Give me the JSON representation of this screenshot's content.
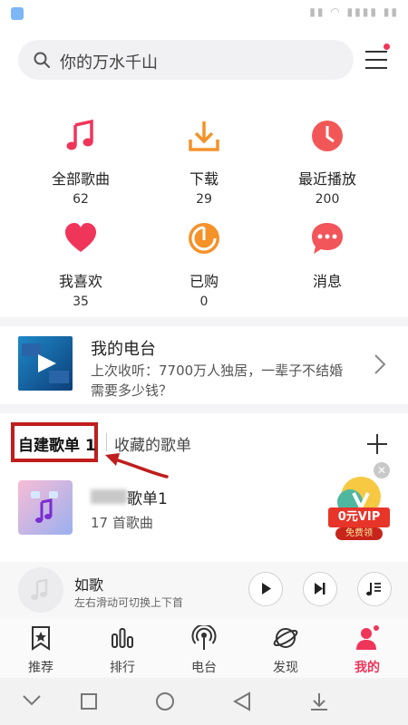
{
  "search": {
    "placeholder": "你的万水千山"
  },
  "grid": [
    {
      "label": "全部歌曲",
      "count": "62",
      "icon": "music-note-icon"
    },
    {
      "label": "下载",
      "count": "29",
      "icon": "download-icon"
    },
    {
      "label": "最近播放",
      "count": "200",
      "icon": "clock-icon"
    },
    {
      "label": "我喜欢",
      "count": "35",
      "icon": "heart-icon"
    },
    {
      "label": "已购",
      "count": "0",
      "icon": "purchased-disc-icon"
    },
    {
      "label": "消息",
      "count": "",
      "icon": "message-icon"
    }
  ],
  "radio": {
    "title": "我的电台",
    "desc": "上次收听：7700万人独居，一辈子不结婚需要多少钱？"
  },
  "tabs": {
    "created": "自建歌单 1",
    "favorited": "收藏的歌单"
  },
  "playlist": {
    "name": "歌单1",
    "count": "17 首歌曲"
  },
  "ad": {
    "main": "0元VIP",
    "sub": "免费领"
  },
  "player": {
    "title": "如歌",
    "hint": "左右滑动可切换上下首"
  },
  "nav": [
    {
      "label": "推荐",
      "icon": "star-bookmark-icon"
    },
    {
      "label": "排行",
      "icon": "chart-bars-icon"
    },
    {
      "label": "电台",
      "icon": "broadcast-icon"
    },
    {
      "label": "发现",
      "icon": "planet-icon"
    },
    {
      "label": "我的",
      "icon": "user-icon"
    }
  ],
  "colors": {
    "accent": "#f0355a",
    "music": "#f0355a",
    "download": "#f5922a",
    "clock": "#f25757",
    "heart": "#f0355a",
    "purchased": "#f5922a",
    "message": "#f2555a",
    "annotation": "#c01d1d"
  }
}
